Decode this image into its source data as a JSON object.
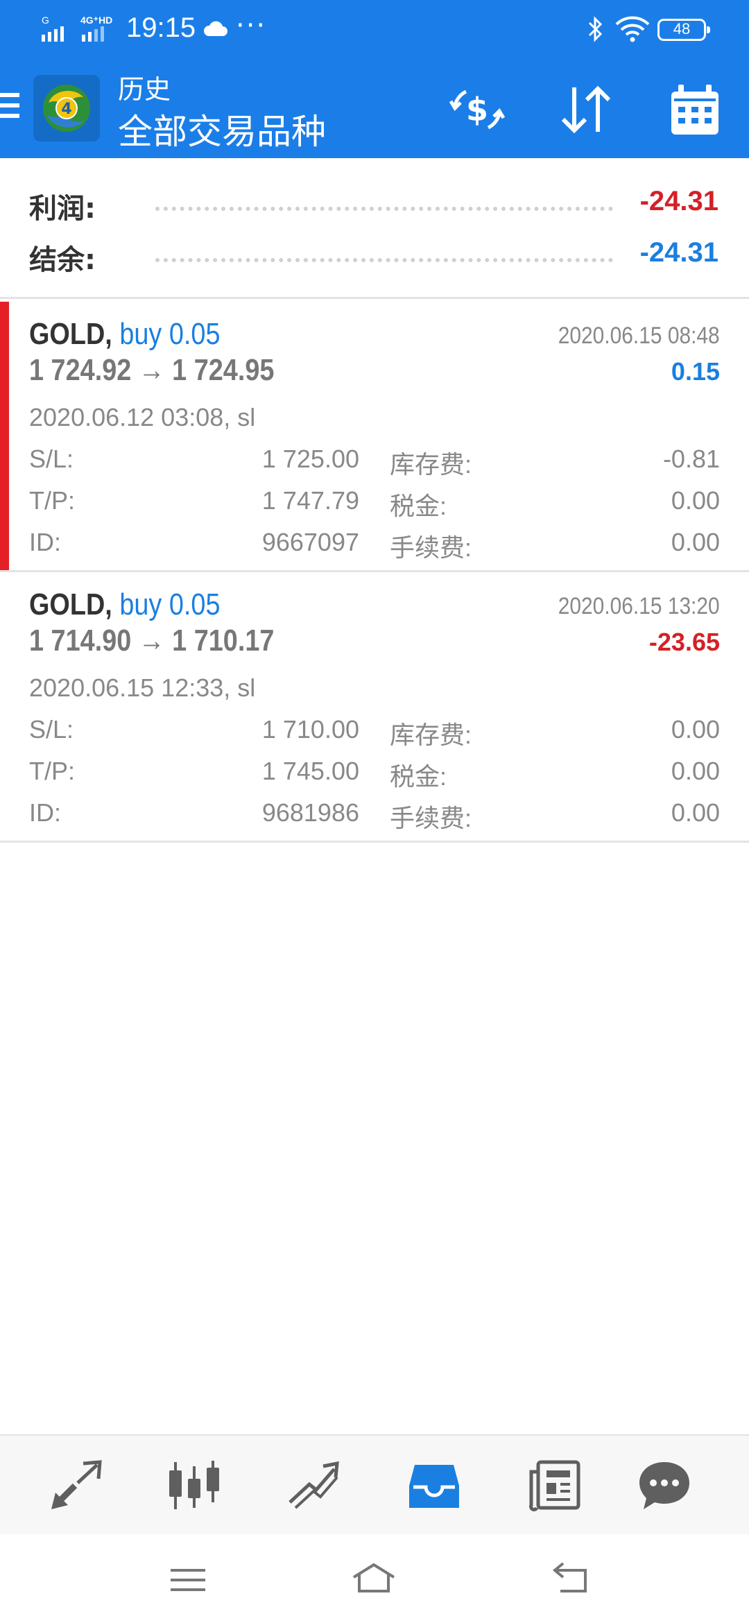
{
  "status_bar": {
    "signal_1_label": "G",
    "signal_2_label": "4G⁺HD",
    "time": "19:15",
    "more": "···",
    "battery": "48"
  },
  "toolbar": {
    "title": "历史",
    "subtitle": "全部交易品种",
    "icons": [
      "menu-icon",
      "mt4-logo",
      "currency-exchange-icon",
      "sort-icon",
      "calendar-icon"
    ]
  },
  "summary": {
    "profit_label": "利润:",
    "profit_value": "-24.31",
    "balance_label": "结余:",
    "balance_value": "-24.31"
  },
  "deals": [
    {
      "symbol": "GOLD,",
      "type": "buy 0.05",
      "close_time": "2020.06.15 08:48",
      "prices": "1 724.92 → 1 724.95",
      "profit": "0.15",
      "open_time": "2020.06.12 03:08, sl",
      "sl_label": "S/L:",
      "sl_value": "1 725.00",
      "tp_label": "T/P:",
      "tp_value": "1 747.79",
      "id_label": "ID:",
      "id_value": "9667097",
      "swap_label": "库存费:",
      "swap_value": "-0.81",
      "tax_label": "税金:",
      "tax_value": "0.00",
      "commission_label": "手续费:",
      "commission_value": "0.00"
    },
    {
      "symbol": "GOLD,",
      "type": "buy 0.05",
      "close_time": "2020.06.15 13:20",
      "prices": "1 714.90 → 1 710.17",
      "profit": "-23.65",
      "open_time": "2020.06.15 12:33, sl",
      "sl_label": "S/L:",
      "sl_value": "1 710.00",
      "tp_label": "T/P:",
      "tp_value": "1 745.00",
      "id_label": "ID:",
      "id_value": "9681986",
      "swap_label": "库存费:",
      "swap_value": "0.00",
      "tax_label": "税金:",
      "tax_value": "0.00",
      "commission_label": "手续费:",
      "commission_value": "0.00"
    }
  ],
  "bottom_nav": [
    "quotes-icon",
    "chart-icon",
    "trade-icon",
    "history-icon",
    "news-icon",
    "chat-icon"
  ],
  "bottom_nav_active": "history-icon",
  "colors": {
    "brand_blue": "#1b7ee8",
    "profit_negative": "#d42027",
    "value_blue": "#1a7fe0",
    "deal_accent": "#e41f26"
  }
}
